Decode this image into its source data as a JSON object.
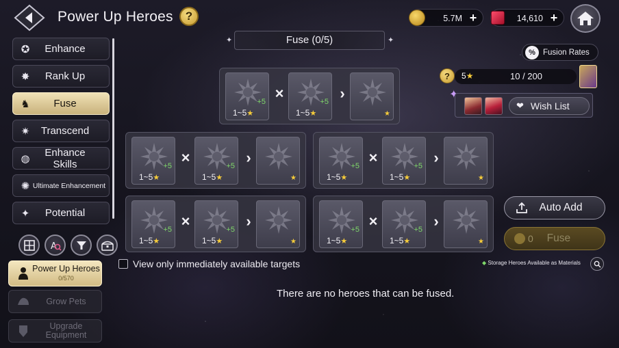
{
  "header": {
    "title": "Power Up Heroes",
    "help": "?",
    "gold": "5.7M",
    "rubies": "14,610",
    "plus": "+"
  },
  "menu": {
    "items": [
      {
        "label": "Enhance",
        "icon": "enhance-icon"
      },
      {
        "label": "Rank Up",
        "icon": "rank-up-icon"
      },
      {
        "label": "Fuse",
        "icon": "fuse-icon",
        "active": true
      },
      {
        "label": "Transcend",
        "icon": "transcend-icon"
      },
      {
        "label": "Enhance Skills",
        "icon": "skills-icon"
      },
      {
        "label": "Ultimate Enhancement",
        "icon": "ultimate-icon"
      },
      {
        "label": "Potential",
        "icon": "potential-icon"
      }
    ]
  },
  "tools": [
    "grid-icon",
    "search-filter-icon",
    "funnel-icon",
    "chest-icon"
  ],
  "nav": {
    "power_up": {
      "label": "Power Up Heroes",
      "sub": "0/570"
    },
    "grow_pets": {
      "label": "Grow Pets"
    },
    "upgrade_equipment": {
      "label": "Upgrade Equipment"
    }
  },
  "fuse": {
    "header": "Fuse (0/5)",
    "range": "1~5",
    "bonus": "+5",
    "times": "×",
    "arrow": "›"
  },
  "right_panel": {
    "fusion_rates": "Fusion Rates",
    "wish_star": "5",
    "wish_count": "10 / 200",
    "wish_list": "Wish List",
    "auto_add": "Auto Add",
    "fuse_cost": "0",
    "fuse_label": "Fuse",
    "storage_note": "Storage Heroes Available as Materials"
  },
  "filter": {
    "label": "View only immediately available targets",
    "checked": false
  },
  "empty_message": "There are no heroes that can be fused.",
  "colors": {
    "accent_gold": "#f6cc3a",
    "bonus_green": "#7fd86a",
    "active_tab": "#e5d4a2"
  }
}
